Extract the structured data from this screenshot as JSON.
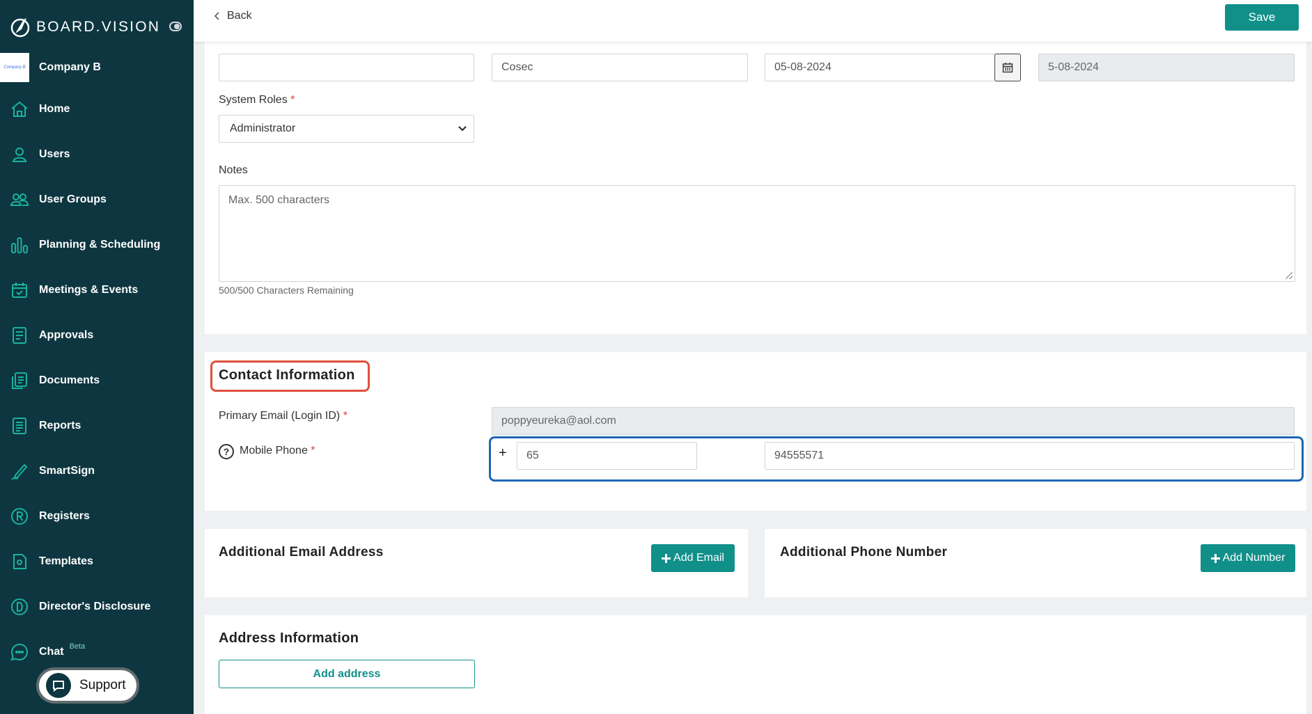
{
  "brand": {
    "name": "BOARD.VISION"
  },
  "company": {
    "logo_text": "Company B",
    "name": "Company B"
  },
  "sidebar": {
    "items": [
      {
        "label": "Home",
        "icon": "home-icon"
      },
      {
        "label": "Users",
        "icon": "user-icon"
      },
      {
        "label": "User Groups",
        "icon": "user-groups-icon"
      },
      {
        "label": "Planning & Scheduling",
        "icon": "bar-chart-icon"
      },
      {
        "label": "Meetings & Events",
        "icon": "calendar-check-icon"
      },
      {
        "label": "Approvals",
        "icon": "approval-doc-icon"
      },
      {
        "label": "Documents",
        "icon": "documents-icon"
      },
      {
        "label": "Reports",
        "icon": "report-list-icon"
      },
      {
        "label": "SmartSign",
        "icon": "pen-sign-icon"
      },
      {
        "label": "Registers",
        "icon": "registered-icon"
      },
      {
        "label": "Templates",
        "icon": "template-icon"
      },
      {
        "label": "Director's Disclosure",
        "icon": "disclosure-d-icon"
      },
      {
        "label": "Chat",
        "icon": "chat-icon",
        "badge": "Beta"
      }
    ],
    "support_label": "Support"
  },
  "topbar": {
    "back_label": "Back",
    "save_label": "Save"
  },
  "form": {
    "field1_value": "",
    "field2_value": "Cosec",
    "date_value": "05-08-2024",
    "date_readonly_value": "5-08-2024",
    "system_roles_label": "System Roles",
    "system_roles_value": "Administrator",
    "notes_label": "Notes",
    "notes_placeholder": "Max. 500 characters",
    "notes_hint": "500/500 Characters Remaining",
    "required_mark": "*"
  },
  "contact": {
    "title": "Contact Information",
    "email_label": "Primary Email (Login ID)",
    "email_value": "poppyeureka@aol.com",
    "mobile_label": "Mobile Phone",
    "help_glyph": "?",
    "plus_glyph": "+",
    "country_code": "65",
    "phone_number": "94555571"
  },
  "additional_email": {
    "title": "Additional Email Address",
    "button": "Add Email"
  },
  "additional_phone": {
    "title": "Additional Phone Number",
    "button": "Add Number"
  },
  "address": {
    "title": "Address Information",
    "button": "Add address"
  },
  "colors": {
    "sidebar": "#0d3640",
    "accent": "#11908a",
    "highlight_red": "#e0503e",
    "highlight_blue": "#1f66b3"
  }
}
